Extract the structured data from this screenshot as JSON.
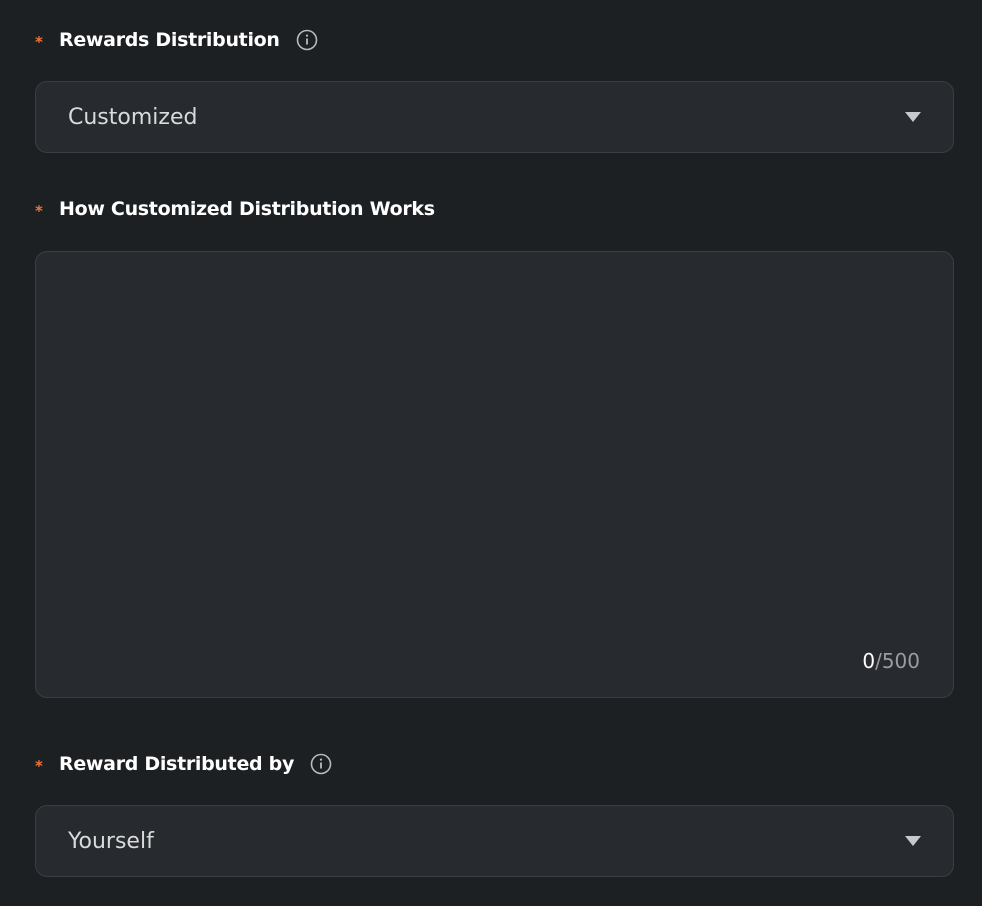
{
  "rewards_distribution": {
    "label": "Rewards Distribution",
    "selected": "Customized"
  },
  "customized_works": {
    "label": "How Customized Distribution Works",
    "value": "",
    "char_count": "0",
    "separator": "/",
    "char_max": "500"
  },
  "distributed_by": {
    "label": "Reward Distributed by",
    "selected": "Yourself"
  },
  "required_marker": "*",
  "colors": {
    "background": "#1d2023",
    "field_background": "#272a2e",
    "field_border": "#3a3d42",
    "required_star": "#e9773a",
    "label": "#ffffff"
  },
  "icons": {
    "info": "info-circle-icon",
    "dropdown": "caret-down-icon"
  }
}
